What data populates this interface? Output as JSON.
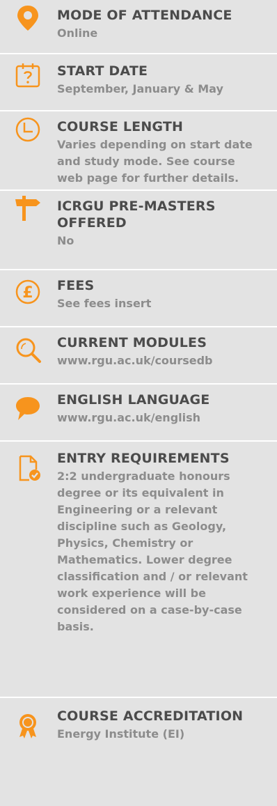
{
  "accent_color": "#f7941d",
  "items": [
    {
      "icon": "map-pin-icon",
      "title": "MODE OF ATTENDANCE",
      "value": "Online"
    },
    {
      "icon": "calendar-question-icon",
      "title": "START DATE",
      "value": "September, January & May"
    },
    {
      "icon": "clock-icon",
      "title": "COURSE LENGTH",
      "value": "Varies depending on start date and study mode. See course web page for further details."
    },
    {
      "icon": "signpost-icon",
      "title": "ICRGU PRE-MASTERS OFFERED",
      "value": "No"
    },
    {
      "icon": "pound-coin-icon",
      "title": "FEES",
      "value": "See fees insert"
    },
    {
      "icon": "magnifier-icon",
      "title": "CURRENT MODULES",
      "value": "www.rgu.ac.uk/coursedb"
    },
    {
      "icon": "speech-bubble-icon",
      "title": "ENGLISH LANGUAGE",
      "value": "www.rgu.ac.uk/english"
    },
    {
      "icon": "document-check-icon",
      "title": "ENTRY REQUIREMENTS",
      "value": "2:2 undergraduate honours degree or its equivalent in Engineering or a relevant discipline such as Geology, Physics, Chemistry or Mathematics. Lower degree classification and / or relevant work experience will be considered on a case-by-case basis."
    },
    {
      "icon": "award-rosette-icon",
      "title": "COURSE ACCREDITATION",
      "value": "Energy Institute (EI)"
    }
  ]
}
